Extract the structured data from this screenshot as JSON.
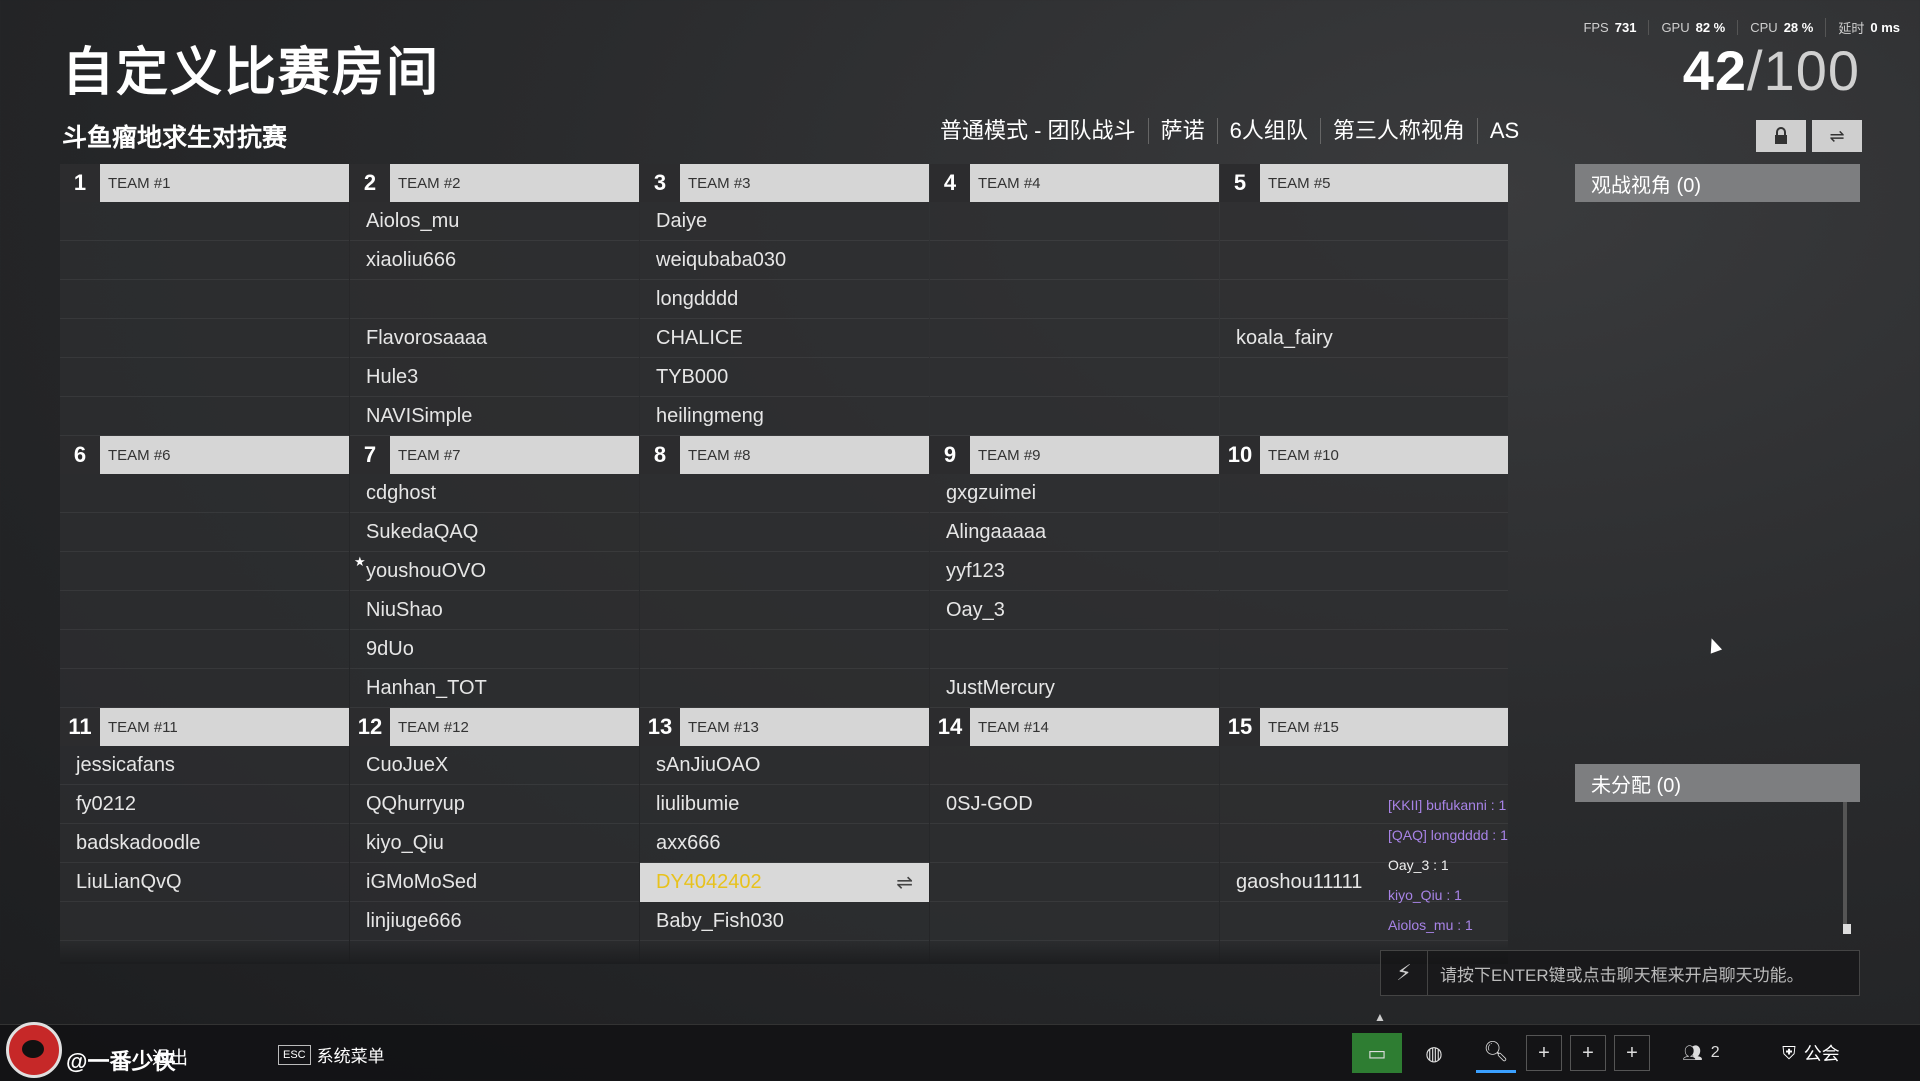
{
  "title": "自定义比赛房间",
  "subtitle": "斗鱼瘤地求生对抗赛",
  "perf": {
    "fps_label": "FPS",
    "fps_value": "731",
    "gpu_label": "GPU",
    "gpu_value": "82 %",
    "cpu_label": "CPU",
    "cpu_value": "28 %",
    "lat_label": "延时",
    "lat_value": "0 ms"
  },
  "counter": {
    "current": "42",
    "max": "/100"
  },
  "modes": [
    "普通模式 - 团队战斗",
    "萨诺",
    "6人组队",
    "第三人称视角",
    "AS"
  ],
  "icons": {
    "lock": "lock-icon",
    "swap": "swap-icon"
  },
  "teams": [
    {
      "num": "1",
      "name": "TEAM #1",
      "players": [
        "",
        "",
        "",
        "",
        "",
        ""
      ]
    },
    {
      "num": "2",
      "name": "TEAM #2",
      "players": [
        "Aiolos_mu",
        "xiaoliu666",
        "",
        "Flavorosaaaa",
        "Hule3",
        "NAVISimple"
      ]
    },
    {
      "num": "3",
      "name": "TEAM #3",
      "players": [
        "Daiye",
        "weiqubaba030",
        "longdddd",
        "CHALICE",
        "TYB000",
        "heilingmeng"
      ]
    },
    {
      "num": "4",
      "name": "TEAM #4",
      "players": [
        "",
        "",
        "",
        "",
        "",
        ""
      ]
    },
    {
      "num": "5",
      "name": "TEAM #5",
      "players": [
        "",
        "",
        "",
        "koala_fairy",
        "",
        ""
      ]
    },
    {
      "num": "6",
      "name": "TEAM #6",
      "players": [
        "",
        "",
        "",
        "",
        "",
        ""
      ]
    },
    {
      "num": "7",
      "name": "TEAM #7",
      "players": [
        "cdghost",
        "SukedaQAQ",
        "youshouOVO",
        "NiuShao",
        "9dUo",
        "Hanhan_TOT"
      ]
    },
    {
      "num": "8",
      "name": "TEAM #8",
      "players": [
        "",
        "",
        "",
        "",
        "",
        ""
      ]
    },
    {
      "num": "9",
      "name": "TEAM #9",
      "players": [
        "gxgzuimei",
        "Alingaaaaa",
        "yyf123",
        "Oay_3",
        "",
        "JustMercury"
      ]
    },
    {
      "num": "10",
      "name": "TEAM #10",
      "players": [
        "",
        "",
        "",
        "",
        "",
        ""
      ]
    },
    {
      "num": "11",
      "name": "TEAM #11",
      "players": [
        "jessicafans",
        "fy0212",
        "badskadoodle",
        "LiuLianQvQ",
        "",
        ""
      ]
    },
    {
      "num": "12",
      "name": "TEAM #12",
      "players": [
        "CuoJueX",
        "QQhurryup",
        "kiyo_Qiu",
        "iGMoMoSed",
        "linjiuge666",
        ""
      ]
    },
    {
      "num": "13",
      "name": "TEAM #13",
      "players": [
        "sAnJiuOAO",
        "liulibumie",
        "axx666",
        "DY4042402",
        "Baby_Fish030",
        ""
      ]
    },
    {
      "num": "14",
      "name": "TEAM #14",
      "players": [
        "",
        "0SJ-GOD",
        "",
        "",
        "",
        ""
      ]
    },
    {
      "num": "15",
      "name": "TEAM #15",
      "players": [
        "",
        "",
        "",
        "gaoshou11111",
        "",
        ""
      ]
    }
  ],
  "spectators": "观战视角 (0)",
  "unassigned": "未分配 (0)",
  "killfeed": [
    {
      "text": "[KKII] bufukanni : 1",
      "tone": "purple"
    },
    {
      "text": "[QAQ] longdddd : 1",
      "tone": "purple"
    },
    {
      "text": "Oay_3 : 1",
      "tone": "white"
    },
    {
      "text": "kiyo_Qiu : 1",
      "tone": "purple"
    },
    {
      "text": "Aiolos_mu : 1",
      "tone": "purple"
    }
  ],
  "chat_hint": "请按下ENTER键或点击聊天框来开启聊天功能。",
  "bottom": {
    "watermark": "@一番少侠",
    "exit": "退出",
    "esc_key": "ESC",
    "system_menu": "系统菜单",
    "friends_count": "2",
    "guild": "公会"
  }
}
